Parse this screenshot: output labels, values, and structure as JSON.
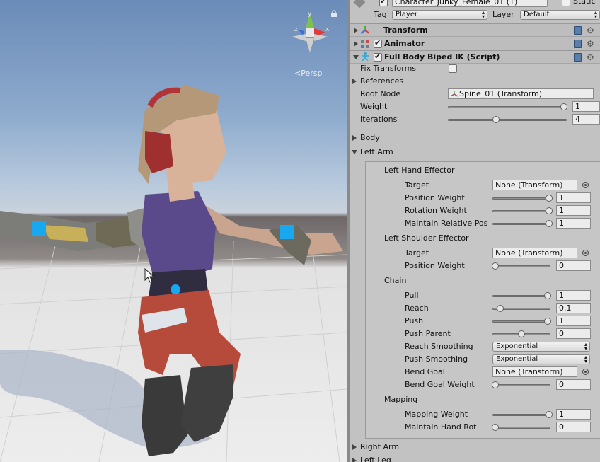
{
  "scene": {
    "persp_label": "Persp",
    "gizmo_axes": {
      "y": "y",
      "x": "x",
      "z": "z"
    },
    "colors": {
      "hair": "#b59878",
      "top": "#5a4a8c",
      "pants": "#b64a3b",
      "skin": "#d8b39a",
      "effector": "#18a8f0"
    }
  },
  "inspector": {
    "object_name": "Character_Junky_Female_01 (1)",
    "static_label": "Static",
    "tag_label": "Tag",
    "tag_value": "Player",
    "layer_label": "Layer",
    "layer_value": "Default",
    "components": {
      "transform": "Transform",
      "animator": "Animator",
      "ik": "Full Body Biped IK (Script)"
    },
    "fix_transforms_label": "Fix Transforms",
    "references_label": "References",
    "root_node_label": "Root Node",
    "root_node_value": "Spine_01 (Transform)",
    "weight_label": "Weight",
    "weight_value": "1",
    "weight_fraction": 1.0,
    "iterations_label": "Iterations",
    "iterations_value": "4",
    "iterations_fraction": 0.4,
    "body_label": "Body",
    "left_arm_label": "Left Arm",
    "left_hand_effector": {
      "title": "Left Hand Effector",
      "target_label": "Target",
      "target_value": "None (Transform)",
      "position_weight_label": "Position Weight",
      "position_weight_value": "1",
      "rotation_weight_label": "Rotation Weight",
      "rotation_weight_value": "1",
      "maintain_label": "Maintain Relative Pos",
      "maintain_value": "1"
    },
    "left_shoulder_effector": {
      "title": "Left Shoulder Effector",
      "target_label": "Target",
      "target_value": "None (Transform)",
      "position_weight_label": "Position Weight",
      "position_weight_value": "0"
    },
    "chain": {
      "title": "Chain",
      "pull_label": "Pull",
      "pull_value": "1",
      "pull_fraction": 1.0,
      "reach_label": "Reach",
      "reach_value": "0.1",
      "reach_fraction": 0.1,
      "push_label": "Push",
      "push_value": "1",
      "push_fraction": 1.0,
      "push_parent_label": "Push Parent",
      "push_parent_value": "0",
      "push_parent_fraction": 0.5,
      "reach_smoothing_label": "Reach Smoothing",
      "reach_smoothing_value": "Exponential",
      "push_smoothing_label": "Push Smoothing",
      "push_smoothing_value": "Exponential",
      "bend_goal_label": "Bend Goal",
      "bend_goal_value": "None (Transform)",
      "bend_goal_weight_label": "Bend Goal Weight",
      "bend_goal_weight_value": "0"
    },
    "mapping": {
      "title": "Mapping",
      "mapping_weight_label": "Mapping Weight",
      "mapping_weight_value": "1",
      "maintain_hand_rot_label": "Maintain Hand Rot",
      "maintain_hand_rot_value": "0"
    },
    "right_arm_label": "Right Arm",
    "left_leg_label": "Left Leg"
  }
}
